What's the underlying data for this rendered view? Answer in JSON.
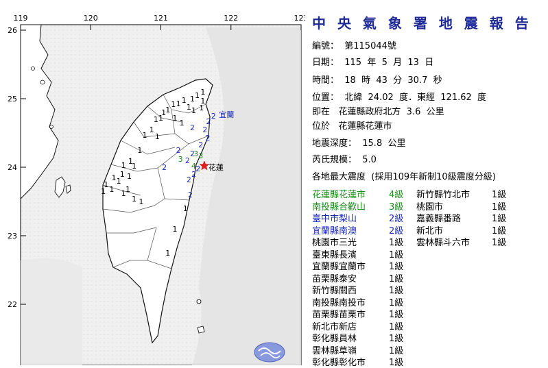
{
  "map": {
    "lon_ticks": [
      "119",
      "120",
      "121",
      "122",
      "123"
    ],
    "lat_ticks": [
      "26",
      "25",
      "24",
      "23",
      "22"
    ],
    "epicenter_label": "花蓮",
    "yilan_label": "宜蘭",
    "colors": {
      "land": "#ffffff",
      "sea": "#eeeeee",
      "border": "#111111",
      "lvl4": "#1a8a1a",
      "lvl3": "#1a8a1a",
      "lvl2": "#1a2ab8",
      "lvl1": "#000000",
      "epicenter": "#e02020"
    },
    "intensity_labels": [
      {
        "v": "1",
        "lon": 121.6,
        "lat": 25.1
      },
      {
        "v": "1",
        "lon": 121.52,
        "lat": 25.05
      },
      {
        "v": "1",
        "lon": 121.45,
        "lat": 25.0
      },
      {
        "v": "1",
        "lon": 121.33,
        "lat": 24.98
      },
      {
        "v": "1",
        "lon": 121.25,
        "lat": 24.93
      },
      {
        "v": "1",
        "lon": 121.18,
        "lat": 24.92
      },
      {
        "v": "1",
        "lon": 121.4,
        "lat": 24.88
      },
      {
        "v": "1",
        "lon": 121.47,
        "lat": 24.83
      },
      {
        "v": "1",
        "lon": 121.6,
        "lat": 24.97
      },
      {
        "v": "1",
        "lon": 121.58,
        "lat": 24.87
      },
      {
        "v": "1",
        "lon": 121.1,
        "lat": 24.84
      },
      {
        "v": "1",
        "lon": 121.04,
        "lat": 24.8
      },
      {
        "v": "1",
        "lon": 121.0,
        "lat": 24.72
      },
      {
        "v": "1",
        "lon": 120.93,
        "lat": 24.7
      },
      {
        "v": "1",
        "lon": 121.2,
        "lat": 24.72
      },
      {
        "v": "1",
        "lon": 121.3,
        "lat": 24.65
      },
      {
        "v": "1",
        "lon": 120.87,
        "lat": 24.55
      },
      {
        "v": "1",
        "lon": 120.77,
        "lat": 24.47
      },
      {
        "v": "1",
        "lon": 120.95,
        "lat": 24.45
      },
      {
        "v": "1",
        "lon": 120.7,
        "lat": 24.25
      },
      {
        "v": "1",
        "lon": 120.57,
        "lat": 24.09
      },
      {
        "v": "1",
        "lon": 120.47,
        "lat": 24.03
      },
      {
        "v": "1",
        "lon": 120.62,
        "lat": 24.02
      },
      {
        "v": "1",
        "lon": 120.45,
        "lat": 23.9
      },
      {
        "v": "1",
        "lon": 120.33,
        "lat": 23.85
      },
      {
        "v": "1",
        "lon": 120.55,
        "lat": 23.87
      },
      {
        "v": "1",
        "lon": 120.4,
        "lat": 23.8
      },
      {
        "v": "1",
        "lon": 120.22,
        "lat": 23.75
      },
      {
        "v": "1",
        "lon": 120.53,
        "lat": 23.68
      },
      {
        "v": "1",
        "lon": 120.3,
        "lat": 23.68
      },
      {
        "v": "1",
        "lon": 120.18,
        "lat": 23.65
      },
      {
        "v": "1",
        "lon": 120.47,
        "lat": 23.62
      },
      {
        "v": "1",
        "lon": 120.62,
        "lat": 23.54
      },
      {
        "v": "1",
        "lon": 120.72,
        "lat": 23.5
      },
      {
        "v": "1",
        "lon": 121.35,
        "lat": 23.4
      },
      {
        "v": "1",
        "lon": 121.2,
        "lat": 23.1
      },
      {
        "v": "1",
        "lon": 121.1,
        "lat": 22.75
      },
      {
        "v": "2",
        "lon": 121.75,
        "lat": 24.75
      },
      {
        "v": "2",
        "lon": 121.68,
        "lat": 24.67
      },
      {
        "v": "2",
        "lon": 121.63,
        "lat": 24.55
      },
      {
        "v": "2",
        "lon": 121.45,
        "lat": 24.58
      },
      {
        "v": "2",
        "lon": 121.67,
        "lat": 24.43
      },
      {
        "v": "2",
        "lon": 121.25,
        "lat": 24.25
      },
      {
        "v": "2",
        "lon": 121.57,
        "lat": 24.33
      },
      {
        "v": "2",
        "lon": 121.45,
        "lat": 24.2
      },
      {
        "v": "2",
        "lon": 121.38,
        "lat": 24.1
      },
      {
        "v": "2",
        "lon": 121.05,
        "lat": 24.0
      },
      {
        "v": "2",
        "lon": 121.53,
        "lat": 23.98
      },
      {
        "v": "2",
        "lon": 121.47,
        "lat": 23.9
      },
      {
        "v": "2",
        "lon": 121.4,
        "lat": 23.82
      },
      {
        "v": "2",
        "lon": 121.42,
        "lat": 23.6
      },
      {
        "v": "3",
        "lon": 121.5,
        "lat": 24.2
      },
      {
        "v": "3",
        "lon": 121.57,
        "lat": 24.17
      },
      {
        "v": "3",
        "lon": 121.28,
        "lat": 24.12
      },
      {
        "v": "4",
        "lon": 121.47,
        "lat": 24.02
      }
    ]
  },
  "report": {
    "title": "中 央 氣 象 署 地 震 報 告",
    "lines": [
      "編號：  第115044號",
      "日期：  115  年  5  月  13  日",
      "時間：  18  時  43  分  30.7  秒",
      "位置：  北緯  24.02  度．東經  121.62  度",
      "即在   花蓮縣政府北方  3.6  公里",
      "位於   花蓮縣花蓮市",
      "地震深度：  15.8  公里",
      "芮氏規模：  5.0",
      "各地最大震度  (採用109年新制10級震度分級)"
    ],
    "left_list": [
      {
        "place": "花蓮縣花蓮市",
        "level": "4級",
        "color": "#1a8a1a"
      },
      {
        "place": "南投縣合歡山",
        "level": "3級",
        "color": "#1a8a1a"
      },
      {
        "place": "臺中市梨山",
        "level": "2級",
        "color": "#1a2ab8"
      },
      {
        "place": "宜蘭縣南澳",
        "level": "2級",
        "color": "#1a2ab8"
      },
      {
        "place": "桃園市三光",
        "level": "1級",
        "color": "#000000"
      },
      {
        "place": "臺東縣長濱",
        "level": "1級",
        "color": "#000000"
      },
      {
        "place": "宜蘭縣宜蘭市",
        "level": "1級",
        "color": "#000000"
      },
      {
        "place": "苗栗縣泰安",
        "level": "1級",
        "color": "#000000"
      },
      {
        "place": "新竹縣關西",
        "level": "1級",
        "color": "#000000"
      },
      {
        "place": "南投縣南投市",
        "level": "1級",
        "color": "#000000"
      },
      {
        "place": "苗栗縣苗栗市",
        "level": "1級",
        "color": "#000000"
      },
      {
        "place": "新北市新店",
        "level": "1級",
        "color": "#000000"
      },
      {
        "place": "彰化縣員林",
        "level": "1級",
        "color": "#000000"
      },
      {
        "place": "雲林縣草嶺",
        "level": "1級",
        "color": "#000000"
      },
      {
        "place": "彰化縣彰化市",
        "level": "1級",
        "color": "#000000"
      }
    ],
    "right_list": [
      {
        "place": "新竹縣竹北市",
        "level": "1級",
        "color": "#000000"
      },
      {
        "place": "桃園市",
        "level": "1級",
        "color": "#000000"
      },
      {
        "place": "嘉義縣番路",
        "level": "1級",
        "color": "#000000"
      },
      {
        "place": "新北市",
        "level": "1級",
        "color": "#000000"
      },
      {
        "place": "雲林縣斗六市",
        "level": "1級",
        "color": "#000000"
      }
    ]
  }
}
